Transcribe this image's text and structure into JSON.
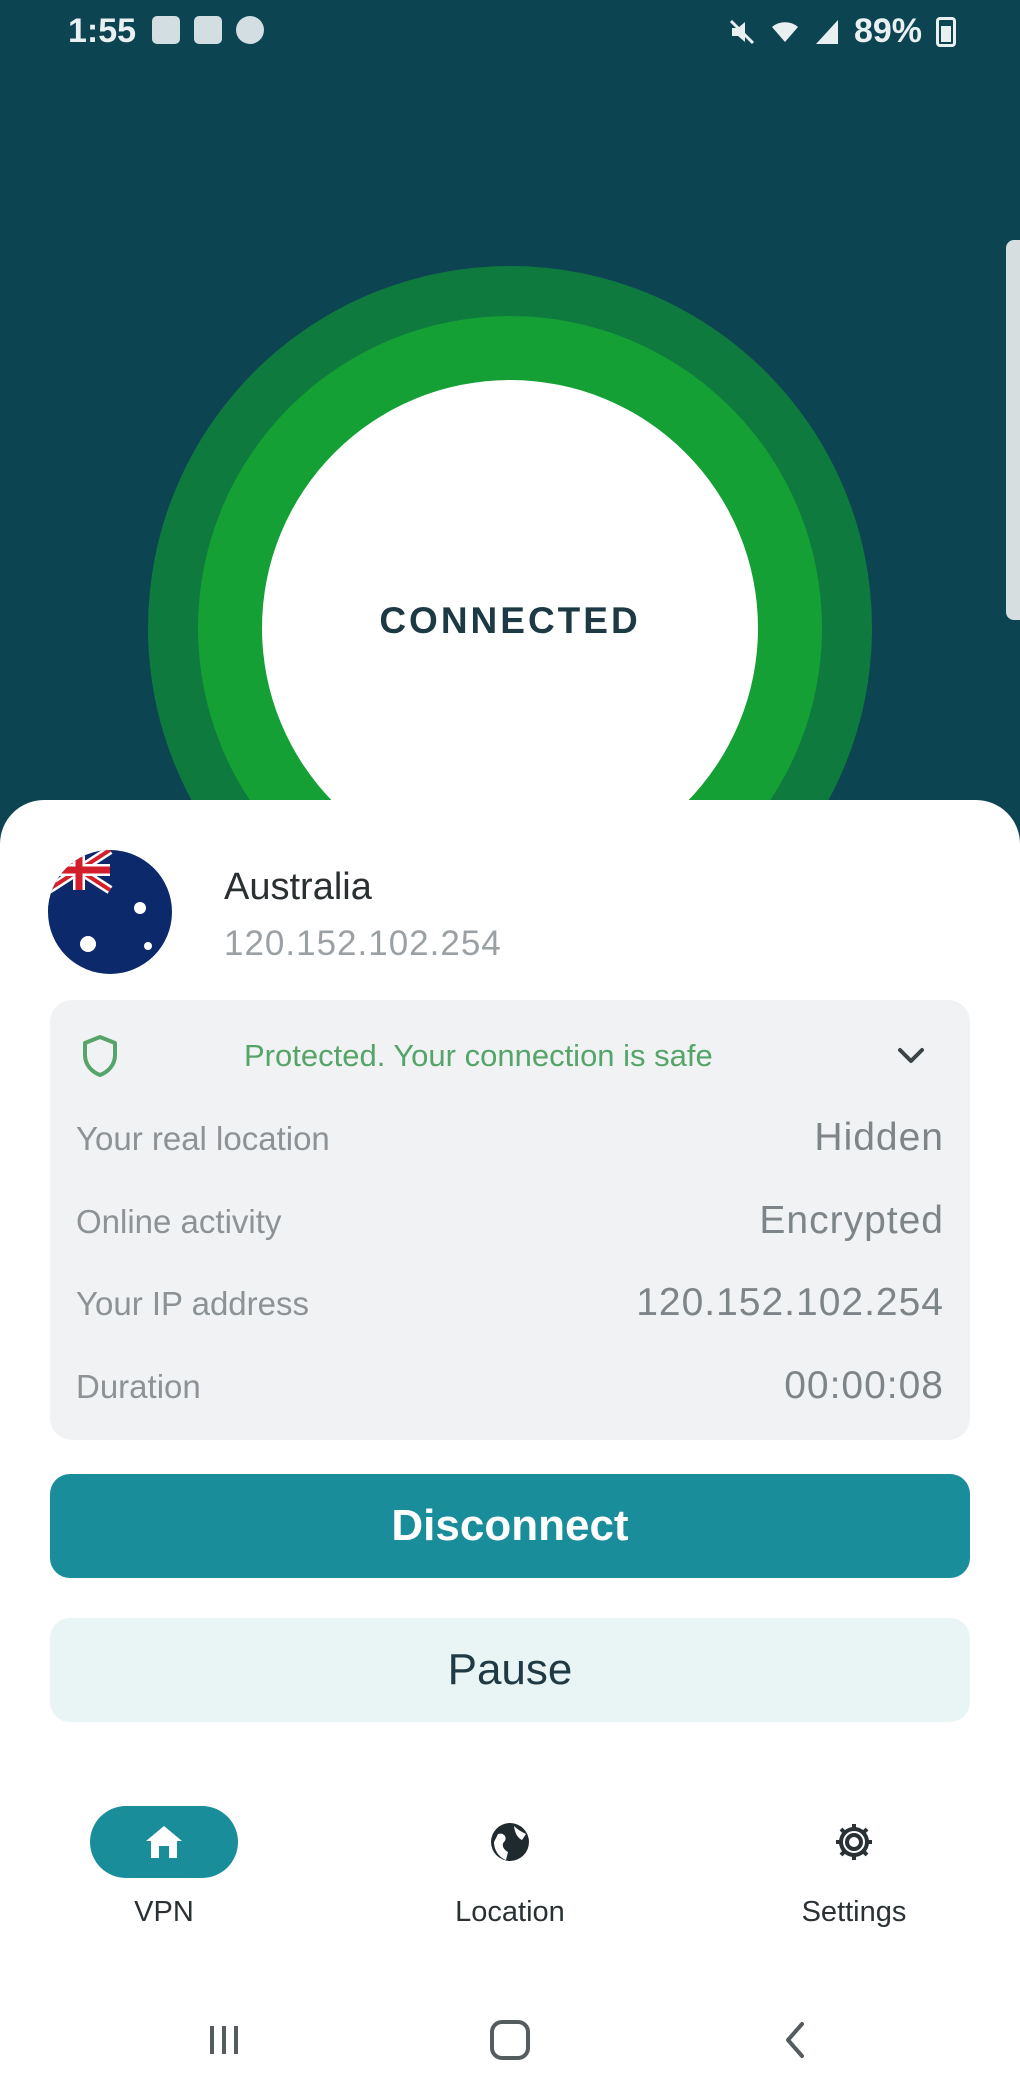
{
  "status_bar": {
    "time": "1:55",
    "battery": "89%",
    "left_icons": [
      "image-icon",
      "account-box-icon",
      "shield-status-icon"
    ],
    "right_icons": [
      "mute-icon",
      "wifi-icon",
      "signal-icon",
      "battery-icon"
    ]
  },
  "connection": {
    "state_label": "CONNECTED",
    "ring_colors": {
      "outer": "#0f7a3e",
      "middle": "#14a035",
      "inner": "#ffffff"
    }
  },
  "server": {
    "country": "Australia",
    "ip": "120.152.102.254",
    "flag_icon": "australia-flag-icon"
  },
  "status_card": {
    "protected_text": "Protected. Your connection is safe",
    "rows": [
      {
        "label": "Your real location",
        "value": "Hidden"
      },
      {
        "label": "Online activity",
        "value": "Encrypted"
      },
      {
        "label": "Your IP address",
        "value": "120.152.102.254"
      },
      {
        "label": "Duration",
        "value": "00:00:08"
      }
    ]
  },
  "actions": {
    "disconnect_label": "Disconnect",
    "pause_label": "Pause"
  },
  "bottom_nav": {
    "items": [
      {
        "label": "VPN",
        "icon": "home-icon",
        "active": true
      },
      {
        "label": "Location",
        "icon": "globe-icon",
        "active": false
      },
      {
        "label": "Settings",
        "icon": "gear-icon",
        "active": false
      }
    ]
  },
  "colors": {
    "header_bg": "#0d4452",
    "accent": "#1a8d9a",
    "protected_green": "#55a56a"
  }
}
